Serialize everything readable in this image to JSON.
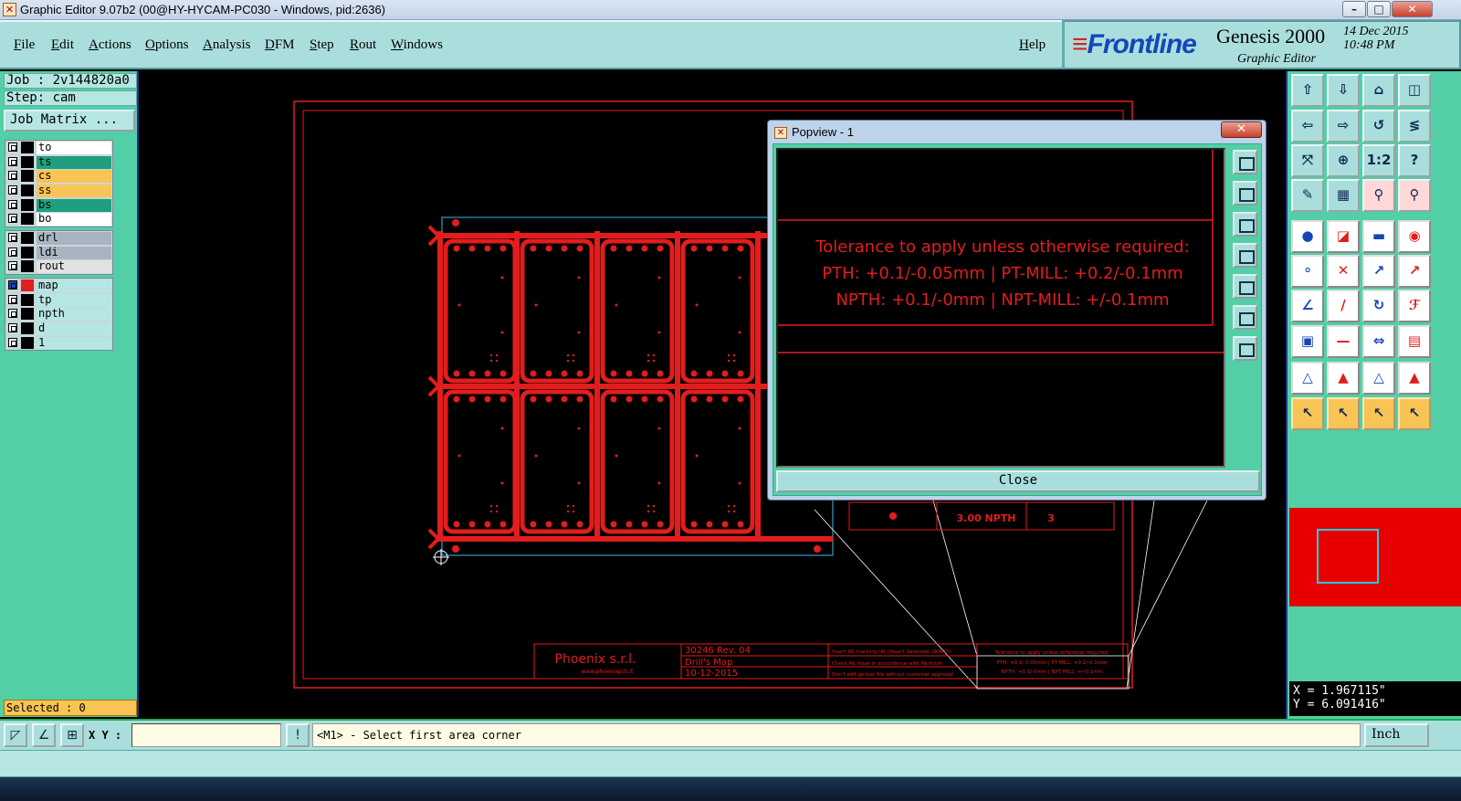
{
  "window": {
    "title": "Graphic Editor 9.07b2 (00@HY-HYCAM-PC030 - Windows, pid:2636)",
    "controls": [
      "–",
      "□",
      "✕"
    ]
  },
  "menu": [
    "File",
    "Edit",
    "Actions",
    "Options",
    "Analysis",
    "DFM",
    "Step",
    "Rout",
    "Windows"
  ],
  "help_label": "Help",
  "brand": {
    "logo": "Frontline",
    "product": "Genesis 2000",
    "subtitle": "Graphic Editor",
    "date": "14 Dec 2015",
    "time": "10:48 PM"
  },
  "job": {
    "job_line": "Job : 2v144820a0",
    "step_line": "Step: cam",
    "matrix_button": "Job Matrix ..."
  },
  "layer_groups": [
    [
      {
        "name": "to",
        "color": "#ffffff"
      },
      {
        "name": "ts",
        "color": "#1f9f7f"
      },
      {
        "name": "cs",
        "color": "#f8c456"
      },
      {
        "name": "ss",
        "color": "#f8c456"
      },
      {
        "name": "bs",
        "color": "#1f9f7f"
      },
      {
        "name": "bo",
        "color": "#ffffff"
      }
    ],
    [
      {
        "name": "drl",
        "color": "#a9b4c2"
      },
      {
        "name": "ldi",
        "color": "#a9b4c2"
      },
      {
        "name": "rout",
        "color": "#e2e2e2"
      }
    ],
    [
      {
        "name": "map",
        "color": "#b5e6e3",
        "active": true
      },
      {
        "name": "tp",
        "color": "#b5e6e3"
      },
      {
        "name": "npth",
        "color": "#b5e6e3"
      },
      {
        "name": "d",
        "color": "#b5e6e3"
      },
      {
        "name": "1",
        "color": "#b5e6e3"
      }
    ]
  ],
  "selected_label": "Selected : 0",
  "drawing": {
    "company": "Phoenix s.r.l.",
    "website": "www.phoenixpcb.it",
    "doc_number": "30246 Rev. 04",
    "doc_title": "Drill's Map",
    "doc_date": "10-12-2015",
    "notes": [
      "Insert UL marking (4) | Insert datacode (WWYY)",
      "Check Pb mask in accordance with Pb-finish",
      "Don't edit gerber file without customer approval"
    ],
    "tolerance_small": [
      "Tolerance to apply unless otherwise required:",
      "PTH: +0.1/-0.05mm | PT-MILL: +0.2/-0.1mm",
      "NPTH: +0.1/-0mm | NPT-MILL: +/-0.1mm"
    ],
    "drill_row": {
      "size": "3.00 NPTH",
      "count": "3"
    }
  },
  "popup": {
    "title": "Popview - 1",
    "close_x": "✕",
    "lines": [
      "Tolerance to apply unless otherwise required:",
      "PTH: +0.1/-0.05mm | PT-MILL: +0.2/-0.1mm",
      "NPTH: +0.1/-0mm | NPT-MILL: +/-0.1mm"
    ],
    "close_button": "Close"
  },
  "toolbar_glyphs": [
    [
      "⇧",
      "⇩",
      "⌂",
      "◫"
    ],
    [
      "⇦",
      "⇨",
      "↺",
      "≶"
    ],
    [
      "⤧",
      "⊕",
      "1:2",
      "?"
    ],
    [
      "✎",
      "▦",
      "⚲",
      "⚲"
    ],
    [
      "●",
      "◪",
      "▬",
      "◉"
    ],
    [
      "⚬",
      "✕",
      "↗",
      "↗"
    ],
    [
      "∠",
      "/",
      "↻",
      "ℱ"
    ],
    [
      "▣",
      "—",
      "⇔",
      "▤"
    ],
    [
      "△",
      "▲",
      "△",
      "▲"
    ],
    [
      "↖",
      "↖",
      "↖",
      "↖"
    ]
  ],
  "coords": {
    "x": "X = 1.967115\"",
    "y": "Y = 6.091416\""
  },
  "bottom": {
    "xy_label": "X Y :",
    "xy_value": "",
    "prompt": "<M1> - Select first area corner",
    "unit": "Inch"
  },
  "colors": {
    "accent_red": "#e21d1d",
    "panel_teal": "#52cfa6",
    "light_teal": "#aadedd"
  }
}
